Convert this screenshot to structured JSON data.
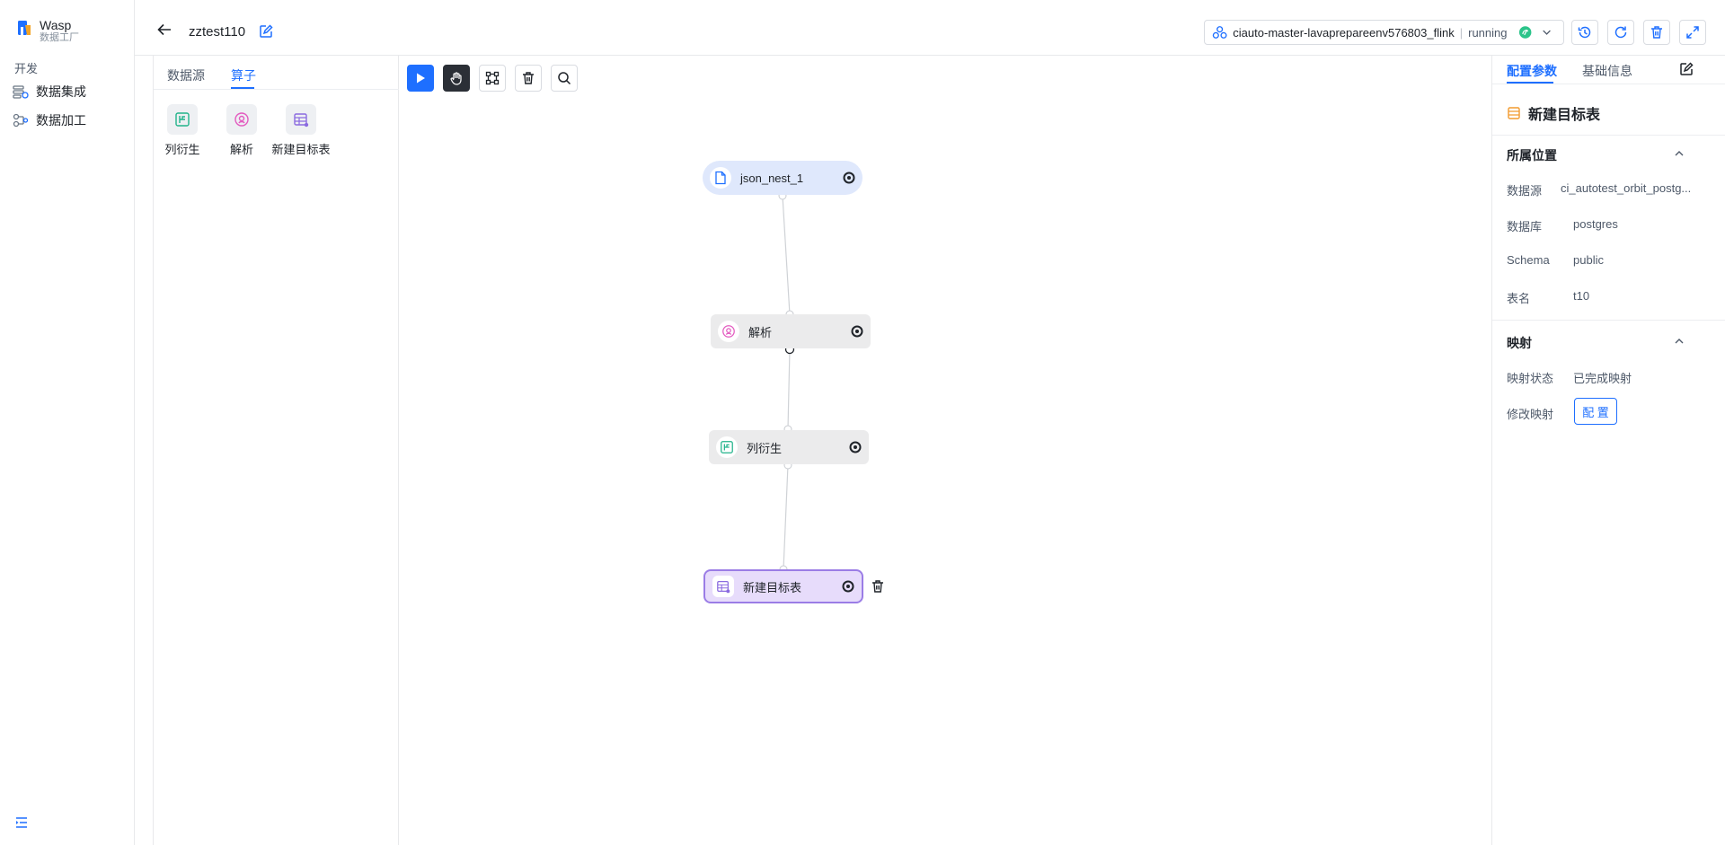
{
  "brand": {
    "name": "Wasp",
    "subtitle": "数据工厂"
  },
  "nav": {
    "section": "开发",
    "items": [
      {
        "label": "数据集成",
        "icon": "data-integration-icon"
      },
      {
        "label": "数据加工",
        "icon": "data-processing-icon"
      }
    ]
  },
  "header": {
    "job_name": "zztest110",
    "cluster_name": "ciauto-master-lavaprepareenv576803_flink",
    "cluster_status": "running"
  },
  "left_panel": {
    "tabs": [
      {
        "label": "数据源",
        "active": false
      },
      {
        "label": "算子",
        "active": true
      }
    ],
    "operators": [
      {
        "label": "列衍生",
        "icon": "derive-column-icon"
      },
      {
        "label": "解析",
        "icon": "parse-icon"
      },
      {
        "label": "新建目标表",
        "icon": "new-target-table-icon"
      }
    ]
  },
  "canvas": {
    "nodes": [
      {
        "label": "json_nest_1",
        "kind": "source"
      },
      {
        "label": "解析",
        "kind": "operator"
      },
      {
        "label": "列衍生",
        "kind": "operator"
      },
      {
        "label": "新建目标表",
        "kind": "target",
        "selected": true
      }
    ]
  },
  "right_panel": {
    "tabs": [
      {
        "label": "配置参数",
        "active": true
      },
      {
        "label": "基础信息",
        "active": false
      }
    ],
    "title": "新建目标表",
    "location": {
      "heading": "所属位置",
      "rows": [
        {
          "key": "数据源",
          "value": "ci_autotest_orbit_postg..."
        },
        {
          "key": "数据库",
          "value": "postgres"
        },
        {
          "key": "Schema",
          "value": "public"
        },
        {
          "key": "表名",
          "value": "t10"
        }
      ]
    },
    "mapping": {
      "heading": "映射",
      "rows": [
        {
          "key": "映射状态",
          "value": "已完成映射"
        },
        {
          "key": "修改映射",
          "value": ""
        }
      ],
      "config_button": "配 置"
    }
  },
  "colors": {
    "accent": "#1e6fff",
    "selected_border": "#9b7de6",
    "source_node": "#dfe8fc"
  }
}
